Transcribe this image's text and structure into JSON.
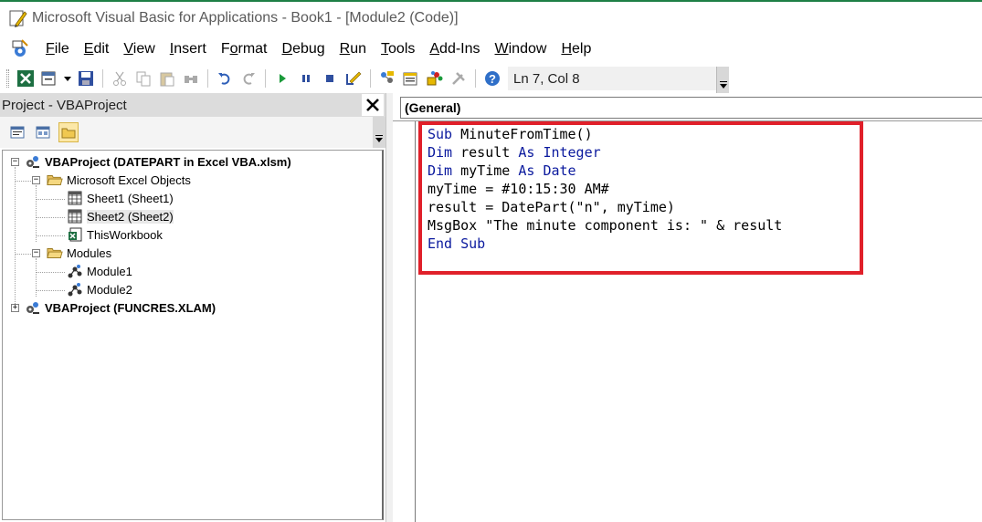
{
  "window": {
    "title": "Microsoft Visual Basic for Applications - Book1 - [Module2 (Code)]"
  },
  "menu": {
    "items": [
      {
        "label": "File",
        "accel": "F"
      },
      {
        "label": "Edit",
        "accel": "E"
      },
      {
        "label": "View",
        "accel": "V"
      },
      {
        "label": "Insert",
        "accel": "I"
      },
      {
        "label": "Format",
        "accel": "o"
      },
      {
        "label": "Debug",
        "accel": "D"
      },
      {
        "label": "Run",
        "accel": "R"
      },
      {
        "label": "Tools",
        "accel": "T"
      },
      {
        "label": "Add-Ins",
        "accel": "A"
      },
      {
        "label": "Window",
        "accel": "W"
      },
      {
        "label": "Help",
        "accel": "H"
      }
    ]
  },
  "toolbar": {
    "cursor_position": "Ln 7, Col 8",
    "icons": [
      "excel-icon",
      "insert-module-icon",
      "save-icon",
      "cut-icon",
      "copy-icon",
      "paste-icon",
      "find-icon",
      "undo-icon",
      "redo-icon",
      "run-icon",
      "break-icon",
      "reset-icon",
      "design-mode-icon",
      "project-explorer-icon",
      "properties-icon",
      "object-browser-icon",
      "toolbox-icon",
      "help-icon"
    ]
  },
  "project_explorer": {
    "title": "Project - VBAProject",
    "close_label": "✕",
    "tree": {
      "project1": "VBAProject (DATEPART in Excel VBA.xlsm)",
      "excel_objects": "Microsoft Excel Objects",
      "sheet1": "Sheet1 (Sheet1)",
      "sheet2": "Sheet2 (Sheet2)",
      "thisworkbook": "ThisWorkbook",
      "modules": "Modules",
      "module1": "Module1",
      "module2": "Module2",
      "project2": "VBAProject (FUNCRES.XLAM)"
    }
  },
  "code_window": {
    "object_dropdown": "(General)",
    "lines": [
      [
        {
          "t": "Sub",
          "kw": true
        },
        {
          "t": " MinuteFromTime()",
          "kw": false
        }
      ],
      [
        {
          "t": "Dim",
          "kw": true
        },
        {
          "t": " result ",
          "kw": false
        },
        {
          "t": "As",
          "kw": true
        },
        {
          "t": " ",
          "kw": false
        },
        {
          "t": "Integer",
          "kw": true
        }
      ],
      [
        {
          "t": "Dim",
          "kw": true
        },
        {
          "t": " myTime ",
          "kw": false
        },
        {
          "t": "As",
          "kw": true
        },
        {
          "t": " ",
          "kw": false
        },
        {
          "t": "Date",
          "kw": true
        }
      ],
      [
        {
          "t": "myTime = #10:15:30 AM#",
          "kw": false
        }
      ],
      [
        {
          "t": "result = DatePart(\"n\", myTime)",
          "kw": false
        }
      ],
      [
        {
          "t": "MsgBox \"The minute component is: \" & result",
          "kw": false
        }
      ],
      [
        {
          "t": "End",
          "kw": true
        },
        {
          "t": " ",
          "kw": false
        },
        {
          "t": "Sub",
          "kw": true
        }
      ]
    ]
  },
  "colors": {
    "keyword": "#0b1a9e",
    "highlight_border": "#e0202a",
    "title_accent": "#1e7f46"
  }
}
